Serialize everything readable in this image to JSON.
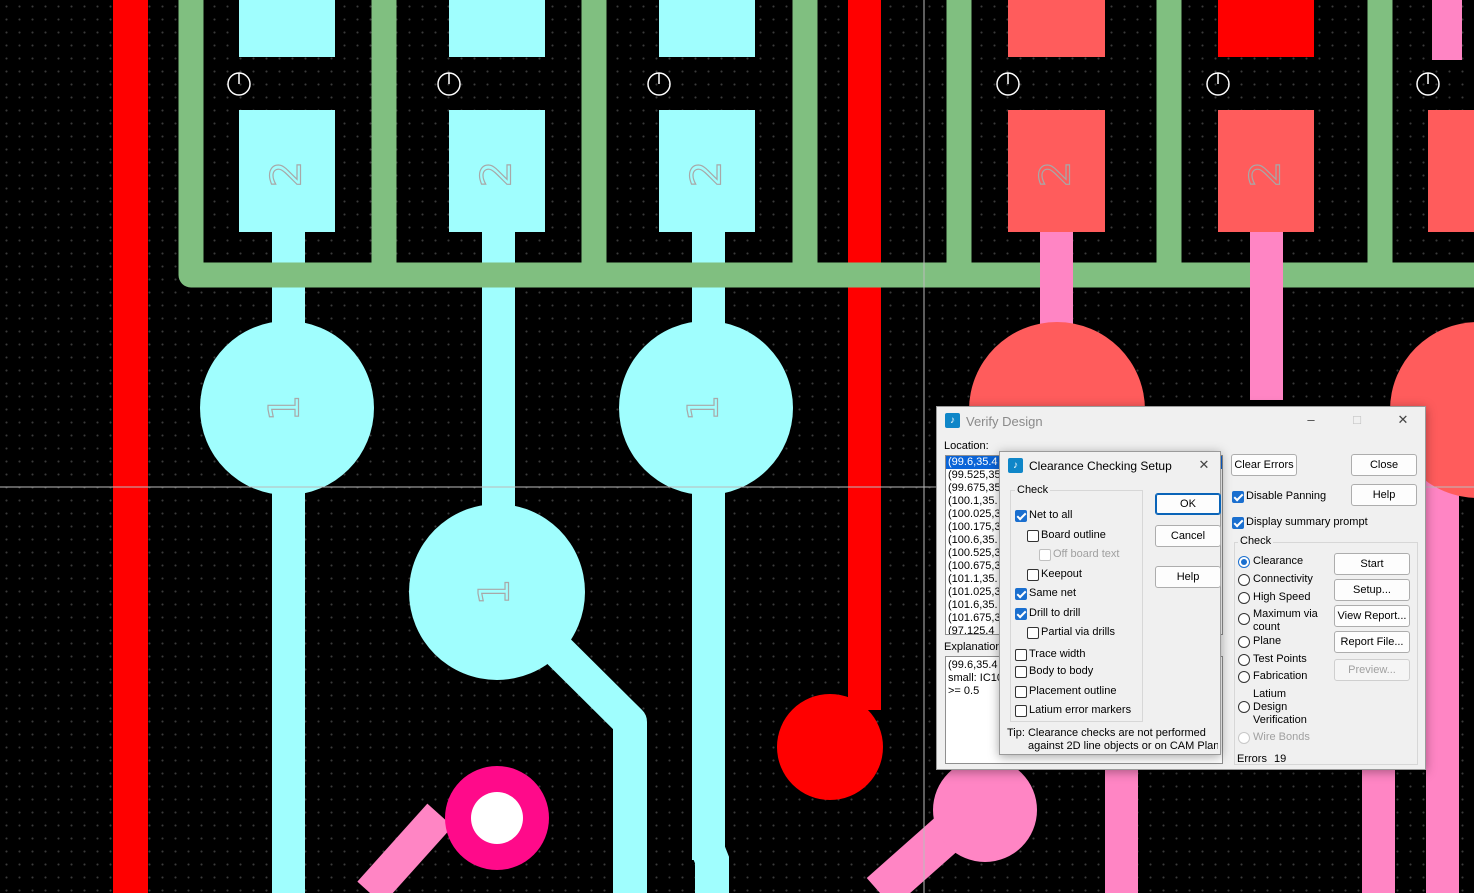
{
  "pcb": {
    "pad_labels": [
      "1",
      "2"
    ],
    "colors": {
      "cyan": "#a0fefe",
      "red": "#ff5c5c",
      "bright_red": "#ff0000",
      "pink": "#ff85c4",
      "magenta": "#ff0a8a",
      "green": "#80bf80"
    }
  },
  "verify": {
    "title": "Verify Design",
    "location_label": "Location:",
    "locations": [
      "(99.6,35.4",
      "(99.525,35",
      "(99.675,35",
      "(100.1,35.",
      "(100.025,3",
      "(100.175,3",
      "(100.6,35.",
      "(100.525,3",
      "(100.675,3",
      "(101.1,35.",
      "(101.025,3",
      "(101.6,35.",
      "(101.675,3",
      "(97.125,4"
    ],
    "explanation_label": "Explanation",
    "explanation_lines": [
      "(99.6,35.4",
      "small: IC10",
      ">= 0.5"
    ],
    "clear_errors": "Clear Errors",
    "close": "Close",
    "help": "Help",
    "disable_panning": "Disable Panning",
    "display_summary": "Display summary prompt",
    "check_label": "Check",
    "options": [
      "Clearance",
      "Connectivity",
      "High Speed",
      "Maximum via count",
      "Plane",
      "Test Points",
      "Fabrication",
      "Latium Design Verification",
      "Wire Bonds"
    ],
    "start": "Start",
    "setup": "Setup...",
    "view_report": "View Report...",
    "report_file": "Report File...",
    "preview": "Preview...",
    "errors_label": "Errors",
    "errors_count": "19"
  },
  "clearance": {
    "title": "Clearance Checking Setup",
    "check_label": "Check",
    "net_to_all": "Net to all",
    "board_outline": "Board outline",
    "off_board_text": "Off board text",
    "keepout": "Keepout",
    "same_net": "Same net",
    "drill_to_drill": "Drill to drill",
    "partial_via": "Partial via drills",
    "trace_width": "Trace width",
    "body_to_body": "Body to body",
    "placement_outline": "Placement outline",
    "latium_markers": "Latium error markers",
    "ok": "OK",
    "cancel": "Cancel",
    "help": "Help",
    "tip_line1": "Tip: Clearance checks are not performed",
    "tip_line2": "against 2D line objects or on CAM Planes"
  }
}
